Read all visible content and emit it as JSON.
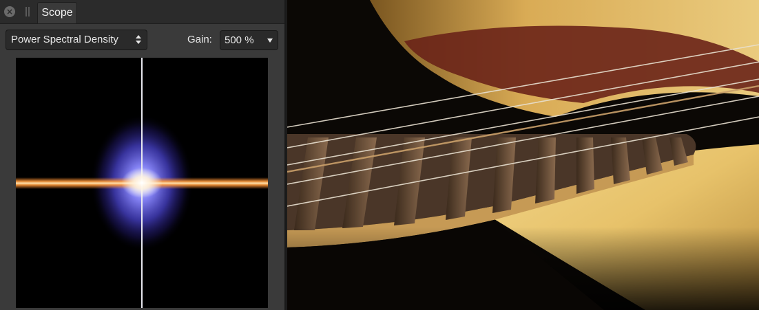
{
  "panel": {
    "tab_label": "Scope",
    "close_symbol": "×",
    "mode": {
      "value": "Power Spectral Density"
    },
    "gain": {
      "label": "Gain:",
      "value": "500 %"
    },
    "scope_view": {
      "icon": "power-spectral-density-plot"
    }
  },
  "image": {
    "subject_icon": "acoustic-guitar-photo"
  },
  "colors": {
    "panel_bg": "#3a3a3a",
    "tabbar_bg": "#2b2b2b",
    "control_bg": "#2a2a2a",
    "text": "#e6e6e6",
    "spectrum_core": "#ffffff",
    "spectrum_band": "#ff9a3a",
    "spectrum_cloud": "#4c4ad8"
  }
}
